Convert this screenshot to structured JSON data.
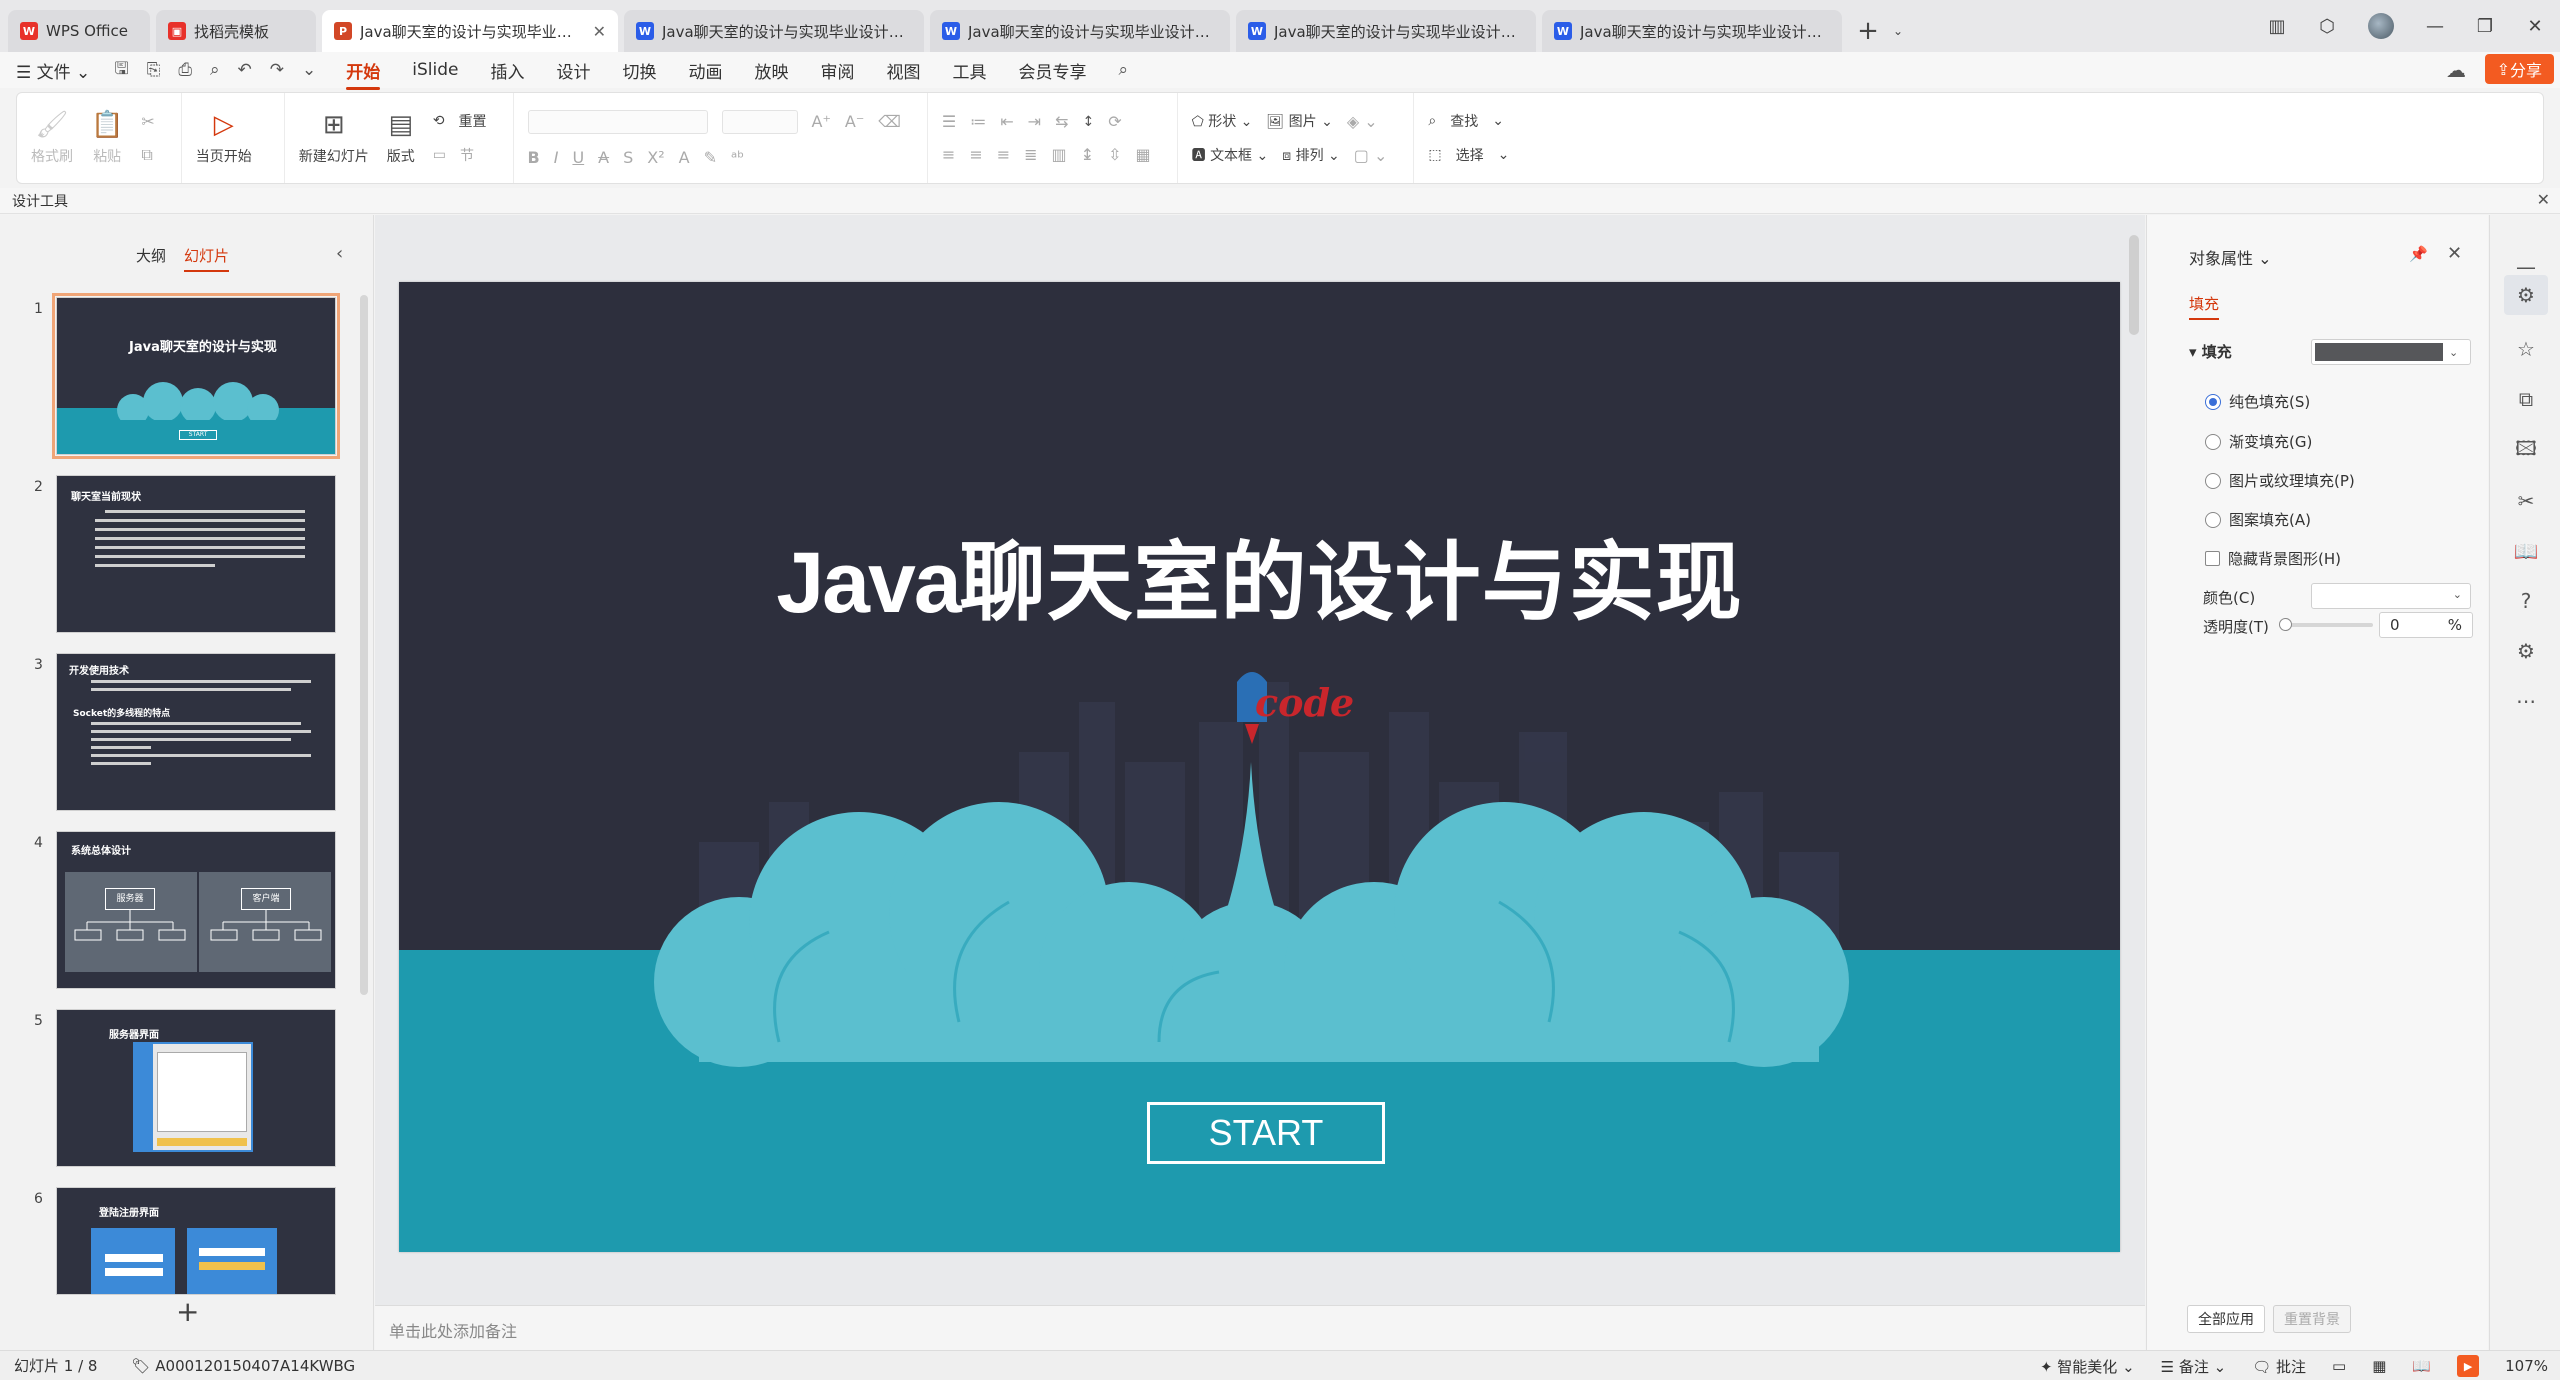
{
  "tabs": [
    {
      "label": "WPS Office",
      "icon": "wps-logo-icon",
      "color": "#e8312a"
    },
    {
      "label": "找稻壳模板",
      "icon": "docer-icon",
      "color": "#e8312a"
    },
    {
      "label": "Java聊天室的设计与实现毕业设计",
      "icon": "ppt-icon",
      "color": "#d24726",
      "active": true
    },
    {
      "label": "Java聊天室的设计与实现毕业设计开题",
      "icon": "word-icon",
      "color": "#2b5de8"
    },
    {
      "label": "Java聊天室的设计与实现毕业设计论文",
      "icon": "word-icon",
      "color": "#2b5de8"
    },
    {
      "label": "Java聊天室的设计与实现毕业设计任务",
      "icon": "word-icon",
      "color": "#2b5de8"
    },
    {
      "label": "Java聊天室的设计与实现毕业设计中期",
      "icon": "word-icon",
      "color": "#2b5de8"
    }
  ],
  "tab_icon_letters": {
    "ppt": "P",
    "word": "W",
    "wps": "W"
  },
  "menu": {
    "file": "文件",
    "items": [
      "开始",
      "iSlide",
      "插入",
      "设计",
      "切换",
      "动画",
      "放映",
      "审阅",
      "视图",
      "工具",
      "会员专享"
    ],
    "active": "开始",
    "share": "分享"
  },
  "ribbon": {
    "format_painter": "格式刷",
    "paste": "粘贴",
    "start_from_current": "当页开始",
    "new_slide": "新建幻灯片",
    "layout": "版式",
    "reset": "重置",
    "section": "节",
    "shape": "形状",
    "picture": "图片",
    "textbox": "文本框",
    "arrange": "排列",
    "find": "查找",
    "select": "选择"
  },
  "design_tools": "设计工具",
  "left_panel": {
    "tab_outline": "大纲",
    "tab_slides": "幻灯片",
    "slides": [
      {
        "num": "1",
        "title": "Java聊天室的设计与实现",
        "btn": "START"
      },
      {
        "num": "2",
        "title": "聊天室当前现状"
      },
      {
        "num": "3",
        "title": "开发使用技术",
        "sub": "Socket的多线程的特点"
      },
      {
        "num": "4",
        "title": "系统总体设计",
        "box1": "服务器",
        "box2": "客户端"
      },
      {
        "num": "5",
        "title": "服务器界面"
      },
      {
        "num": "6",
        "title": "登陆注册界面"
      }
    ]
  },
  "slide": {
    "title_prefix": "Java",
    "title_rest": "聊天室的设计与实现",
    "logo_text": "code",
    "start": "START",
    "bg_color": "#2d2f3d",
    "sea_color": "#1e9aae",
    "cloud_color": "#5bbfcf"
  },
  "notes_placeholder": "单击此处添加备注",
  "props": {
    "title": "对象属性",
    "tab_fill": "填充",
    "fill_header": "填充",
    "options": [
      "纯色填充(S)",
      "渐变填充(G)",
      "图片或纹理填充(P)",
      "图案填充(A)"
    ],
    "selected_option": "纯色填充(S)",
    "hide_bg": "隐藏背景图形(H)",
    "color_label": "颜色(C)",
    "transparency_label": "透明度(T)",
    "transparency_value": "0",
    "transparency_unit": "%",
    "apply_all": "全部应用",
    "reset_bg": "重置背景",
    "fill_color": "#56575a"
  },
  "status": {
    "slide_count": "幻灯片 1 / 8",
    "doc_id": "A000120150407A14KWBG",
    "smart_beautify": "智能美化",
    "notes": "备注",
    "comments": "批注",
    "zoom": "107%"
  }
}
